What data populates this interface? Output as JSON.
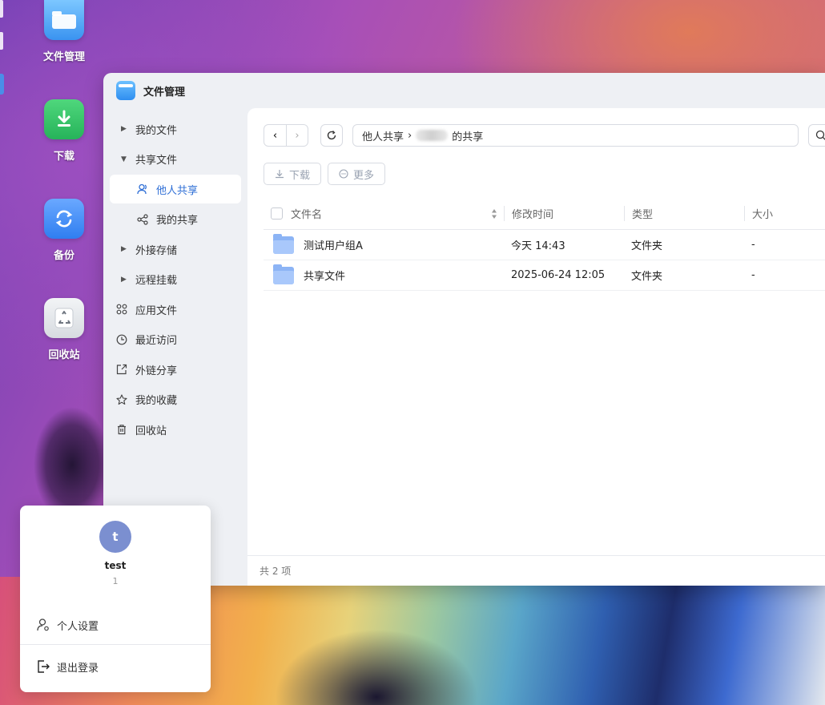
{
  "desktop": {
    "icons": [
      {
        "label": "文件管理"
      },
      {
        "label": "下载"
      },
      {
        "label": "备份"
      },
      {
        "label": "回收站"
      }
    ]
  },
  "window": {
    "title": "文件管理",
    "sidebar": {
      "items": [
        {
          "label": "我的文件"
        },
        {
          "label": "共享文件"
        },
        {
          "label": "他人共享"
        },
        {
          "label": "我的共享"
        },
        {
          "label": "外接存储"
        },
        {
          "label": "远程挂载"
        },
        {
          "label": "应用文件"
        },
        {
          "label": "最近访问"
        },
        {
          "label": "外链分享"
        },
        {
          "label": "我的收藏"
        },
        {
          "label": "回收站"
        }
      ]
    },
    "path": {
      "root": "他人共享",
      "separator": "›",
      "suffix": "的共享"
    },
    "actions": {
      "download": "下载",
      "more": "更多"
    },
    "table": {
      "headers": {
        "name": "文件名",
        "modified": "修改时间",
        "type": "类型",
        "size": "大小"
      },
      "rows": [
        {
          "name": "测试用户组A",
          "modified": "今天 14:43",
          "type": "文件夹",
          "size": "-"
        },
        {
          "name": "共享文件",
          "modified": "2025-06-24 12:05",
          "type": "文件夹",
          "size": "-"
        }
      ]
    },
    "footer": {
      "count_text": "共 2 项"
    }
  },
  "user_popup": {
    "avatar_letter": "t",
    "username": "test",
    "user_id": "1",
    "settings_label": "个人设置",
    "logout_label": "退出登录"
  },
  "colors": {
    "accent": "#2f6fd6",
    "folder": "#8cb4f5",
    "avatar": "#7b8fd0"
  }
}
